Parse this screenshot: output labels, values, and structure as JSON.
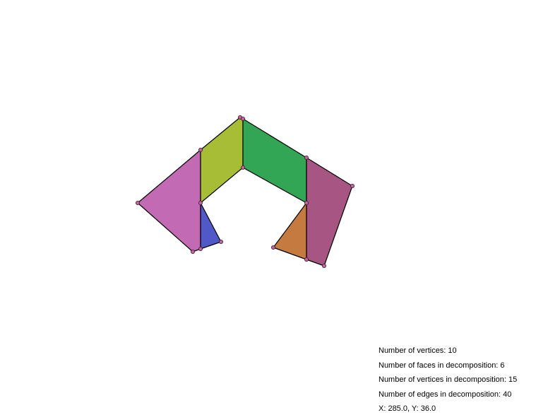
{
  "faces": [
    {
      "name": "face-pink-left",
      "color": "#c36ab5"
    },
    {
      "name": "face-blue-triangle",
      "color": "#5158c7"
    },
    {
      "name": "face-yellow-green",
      "color": "#a6bd35"
    },
    {
      "name": "face-green",
      "color": "#33a656"
    },
    {
      "name": "face-magenta-right",
      "color": "#a75683"
    },
    {
      "name": "face-orange-triangle",
      "color": "#c57a3f"
    }
  ],
  "vertex_color": "#c2679c",
  "edge_color": "#000000",
  "stats": {
    "vertices_label": "Number of vertices: 10",
    "faces_label": "Number of faces in decomposition: 6",
    "decomp_vertices_label": "Number of vertices in decomposition: 15",
    "edges_label": "Number of edges in decomposition: 40",
    "coords_label": "X: 285.0, Y: 36.0"
  }
}
